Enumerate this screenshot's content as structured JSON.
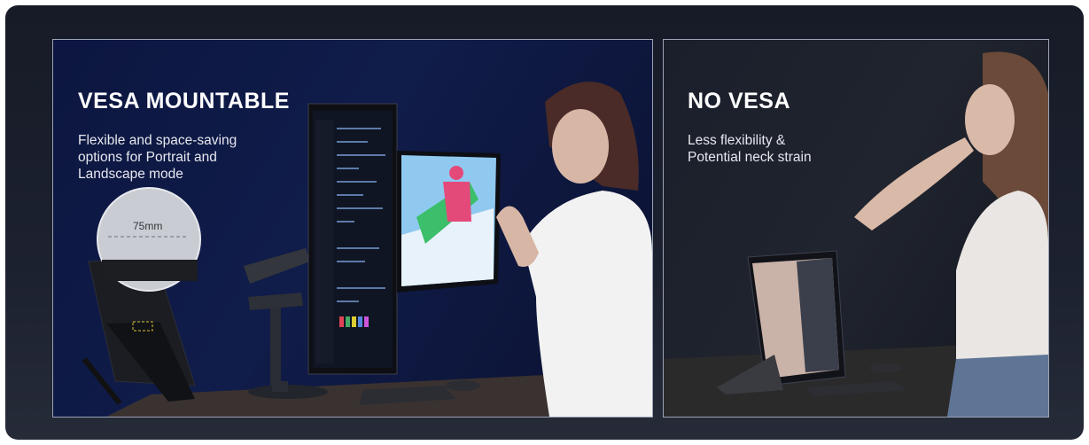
{
  "left_panel": {
    "heading": "VESA MOUNTABLE",
    "description_lines": [
      "Flexible and space-saving",
      "options for Portrait and",
      "Landscape mode"
    ],
    "measurement_label": "75mm"
  },
  "right_panel": {
    "heading": "NO VESA",
    "description_lines": [
      "Less flexibility &",
      "Potential neck strain"
    ]
  }
}
